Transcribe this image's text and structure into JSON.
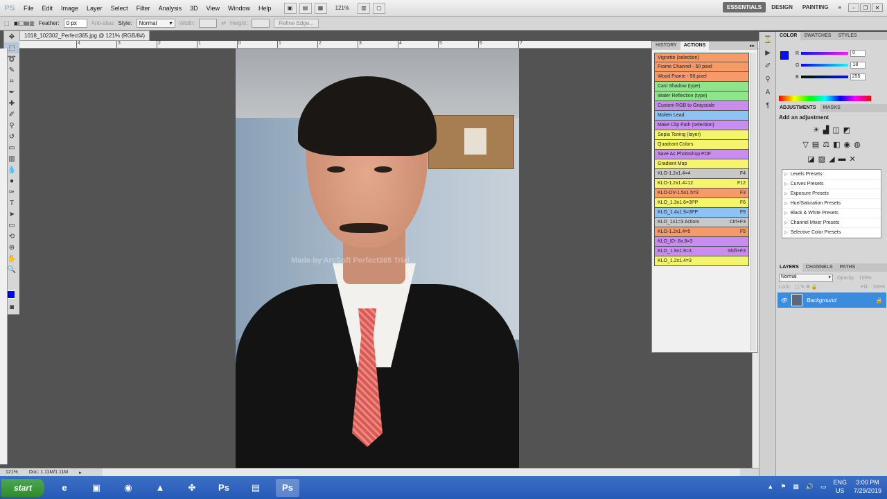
{
  "app": {
    "logo": "PS",
    "menus": [
      "File",
      "Edit",
      "Image",
      "Layer",
      "Select",
      "Filter",
      "Analysis",
      "3D",
      "View",
      "Window",
      "Help"
    ],
    "zoom": "121%",
    "workspaces": [
      "ESSENTIALS",
      "DESIGN",
      "PAINTING"
    ],
    "more": "»"
  },
  "options": {
    "feather_label": "Feather:",
    "feather_value": "0 px",
    "antialias_label": "Anti-alias",
    "style_label": "Style:",
    "style_value": "Normal",
    "width_label": "Width:",
    "height_label": "Height:",
    "refine_label": "Refine Edge..."
  },
  "document": {
    "tab_title": "1018_102302_Perfect365.jpg @ 121% (RGB/8#)",
    "status_zoom": "121%",
    "status_doc": "Doc: 1.11M/1.11M",
    "watermark": "Made by ArcSoft Perfect365 Trial",
    "ruler_ticks": [
      "4",
      "3",
      "2",
      "1",
      "0",
      "1",
      "2",
      "3",
      "4",
      "5",
      "6",
      "7"
    ]
  },
  "actions_panel": {
    "tabs": [
      "HISTORY",
      "ACTIONS"
    ],
    "items": [
      {
        "label": "Vignette (selection)",
        "key": "",
        "color": "#f79a6a"
      },
      {
        "label": "Frame Channel - 50 pixel",
        "key": "",
        "color": "#f79a6a"
      },
      {
        "label": "Wood Frame - 50 pixel",
        "key": "",
        "color": "#f79a6a"
      },
      {
        "label": "Cast Shadow (type)",
        "key": "",
        "color": "#8ee68b"
      },
      {
        "label": "Water Reflection (type)",
        "key": "",
        "color": "#8ee68b"
      },
      {
        "label": "Custom RGB to Grayscale",
        "key": "",
        "color": "#c98cf0"
      },
      {
        "label": "Molten Lead",
        "key": "",
        "color": "#8cc3f5"
      },
      {
        "label": "Make Clip Path (selection)",
        "key": "",
        "color": "#c98cf0"
      },
      {
        "label": "Sepia Toning (layer)",
        "key": "",
        "color": "#f5f56a"
      },
      {
        "label": "Quadrant Colors",
        "key": "",
        "color": "#f5f56a"
      },
      {
        "label": "Save As Photoshop PDF",
        "key": "",
        "color": "#c98cf0"
      },
      {
        "label": "Gradient Map",
        "key": "",
        "color": "#f5f56a"
      },
      {
        "label": "KLO-1.2x1.4=4",
        "key": "F4",
        "color": "#c8c8c8"
      },
      {
        "label": "KLO-1.2x1.4=12",
        "key": "F12",
        "color": "#f5f56a"
      },
      {
        "label": "KLO-DV-1.5x1.5=3",
        "key": "F3",
        "color": "#f79a6a"
      },
      {
        "label": "KLO_1.3x1.6=3PP",
        "key": "F6",
        "color": "#f5f56a"
      },
      {
        "label": "KLO_1.4x1.9=3PP",
        "key": "F9",
        "color": "#8cc3f5"
      },
      {
        "label": "KLO_1x1=3 Actiom",
        "key": "Ctrl+F3",
        "color": "#c8c8c8"
      },
      {
        "label": "KLO-1.2x1.4=5",
        "key": "F5",
        "color": "#f79a6a"
      },
      {
        "label": "KLO_ID-.8x.8=3",
        "key": "",
        "color": "#c98cf0"
      },
      {
        "label": "KLO_1.9x1.9=3",
        "key": "Shift+F3",
        "color": "#c98cf0"
      },
      {
        "label": "KLO_1.2x1.4=3",
        "key": "",
        "color": "#f5f56a"
      }
    ]
  },
  "color_panel": {
    "tabs": [
      "COLOR",
      "SWATCHES",
      "STYLES"
    ],
    "r_label": "R",
    "r_value": "0",
    "g_label": "G",
    "g_value": "18",
    "b_label": "B",
    "b_value": "255"
  },
  "adjustments": {
    "tabs": [
      "ADJUSTMENTS",
      "MASKS"
    ],
    "title": "Add an adjustment",
    "presets": [
      "Levels Presets",
      "Curves Presets",
      "Exposure Presets",
      "Hue/Saturation Presets",
      "Black & White Presets",
      "Channel Mixer Presets",
      "Selective Color Presets"
    ]
  },
  "layers": {
    "tabs": [
      "LAYERS",
      "CHANNELS",
      "PATHS"
    ],
    "blend_mode": "Normal",
    "opacity_label": "Opacity:",
    "opacity": "100%",
    "lock_label": "Lock:",
    "fill_label": "Fill:",
    "fill": "100%",
    "layer_name": "Background"
  },
  "taskbar": {
    "start": "start",
    "lang": "ENG",
    "region": "US",
    "time": "3:00 PM",
    "date": "7/29/2019"
  }
}
